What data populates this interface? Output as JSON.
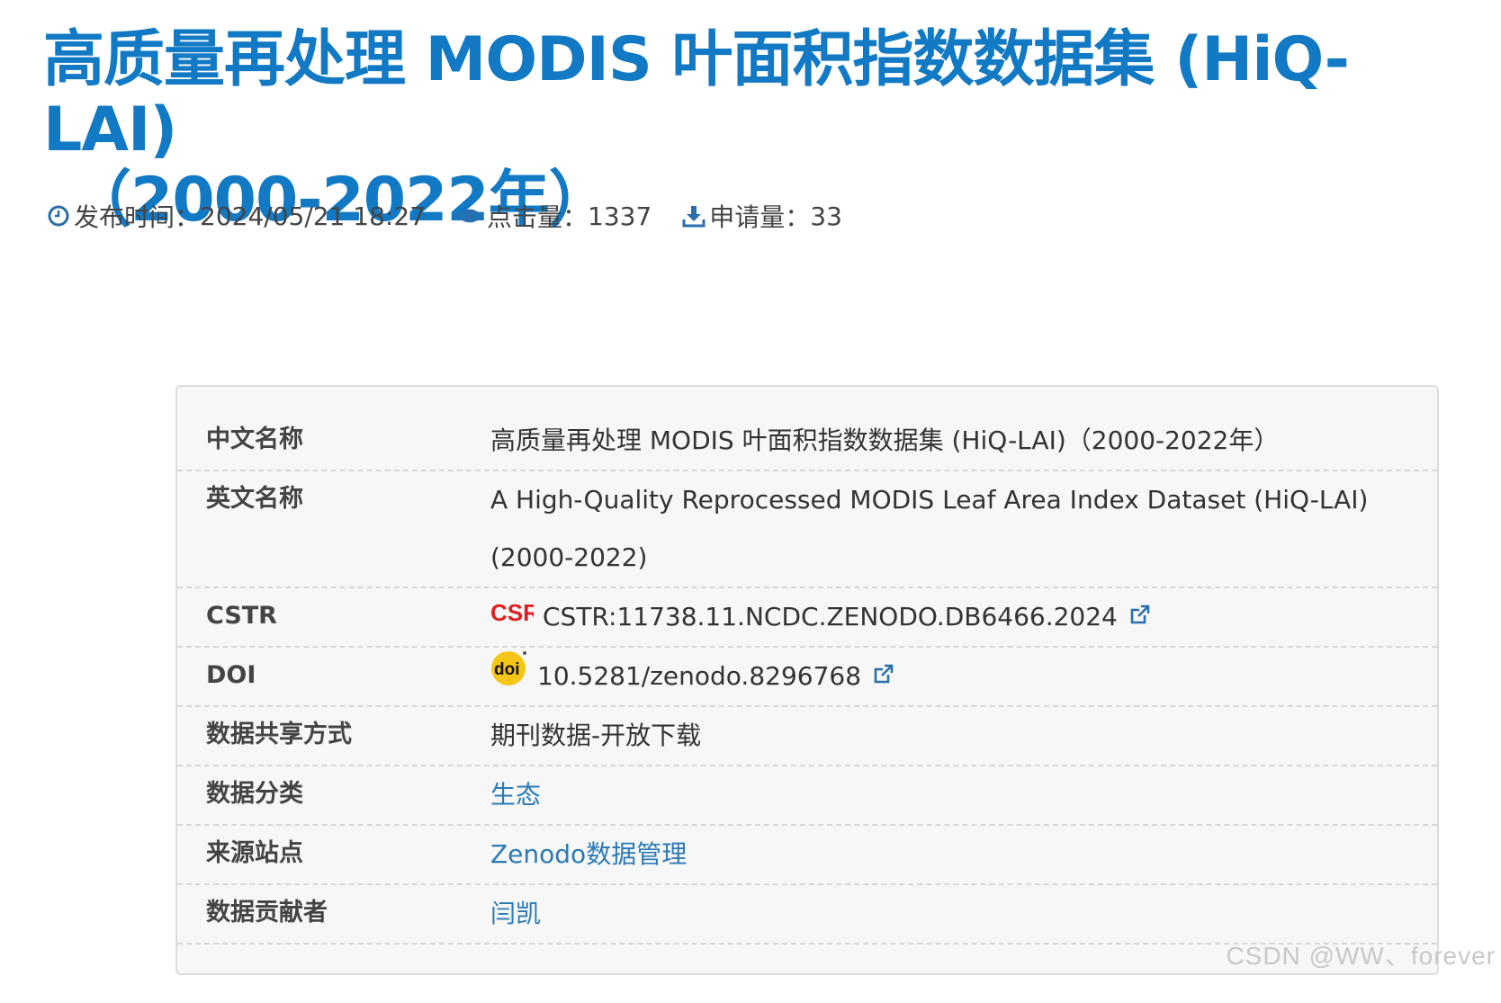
{
  "title": {
    "line1": "高质量再处理 MODIS 叶面积指数数据集 (HiQ-LAI)",
    "line2": "（2000-2022年）"
  },
  "meta": {
    "publish_label": "发布时间：",
    "publish_value": "2024/05/21 18:27",
    "views_label": "点击量：",
    "views_value": "1337",
    "requests_label": "申请量：",
    "requests_value": "33"
  },
  "info": {
    "cn_name_key": "中文名称",
    "cn_name_val": "高质量再处理 MODIS 叶面积指数数据集 (HiQ-LAI)（2000-2022年）",
    "en_name_key": "英文名称",
    "en_name_val": "A High-Quality Reprocessed MODIS Leaf Area Index Dataset (HiQ-LAI) (2000-2022)",
    "cstr_key": "CSTR",
    "cstr_val": "CSTR:11738.11.NCDC.ZENODO.DB6466.2024",
    "doi_key": "DOI",
    "doi_val": "10.5281/zenodo.8296768",
    "share_key": "数据共享方式",
    "share_val": "期刊数据-开放下载",
    "category_key": "数据分类",
    "category_val": "生态",
    "source_key": "来源站点",
    "source_val": "Zenodo数据管理",
    "contributor_key": "数据贡献者",
    "contributor_val": "闫凯"
  },
  "logos": {
    "cstr_text": "CSR",
    "doi_text": "doi"
  },
  "watermark": "CSDN @WW、forever",
  "colors": {
    "title": "#1279c4",
    "link": "#2a7ab5",
    "icon": "#2a6eab",
    "cstr_logo": "#e02020",
    "doi_logo": "#f5c518"
  }
}
